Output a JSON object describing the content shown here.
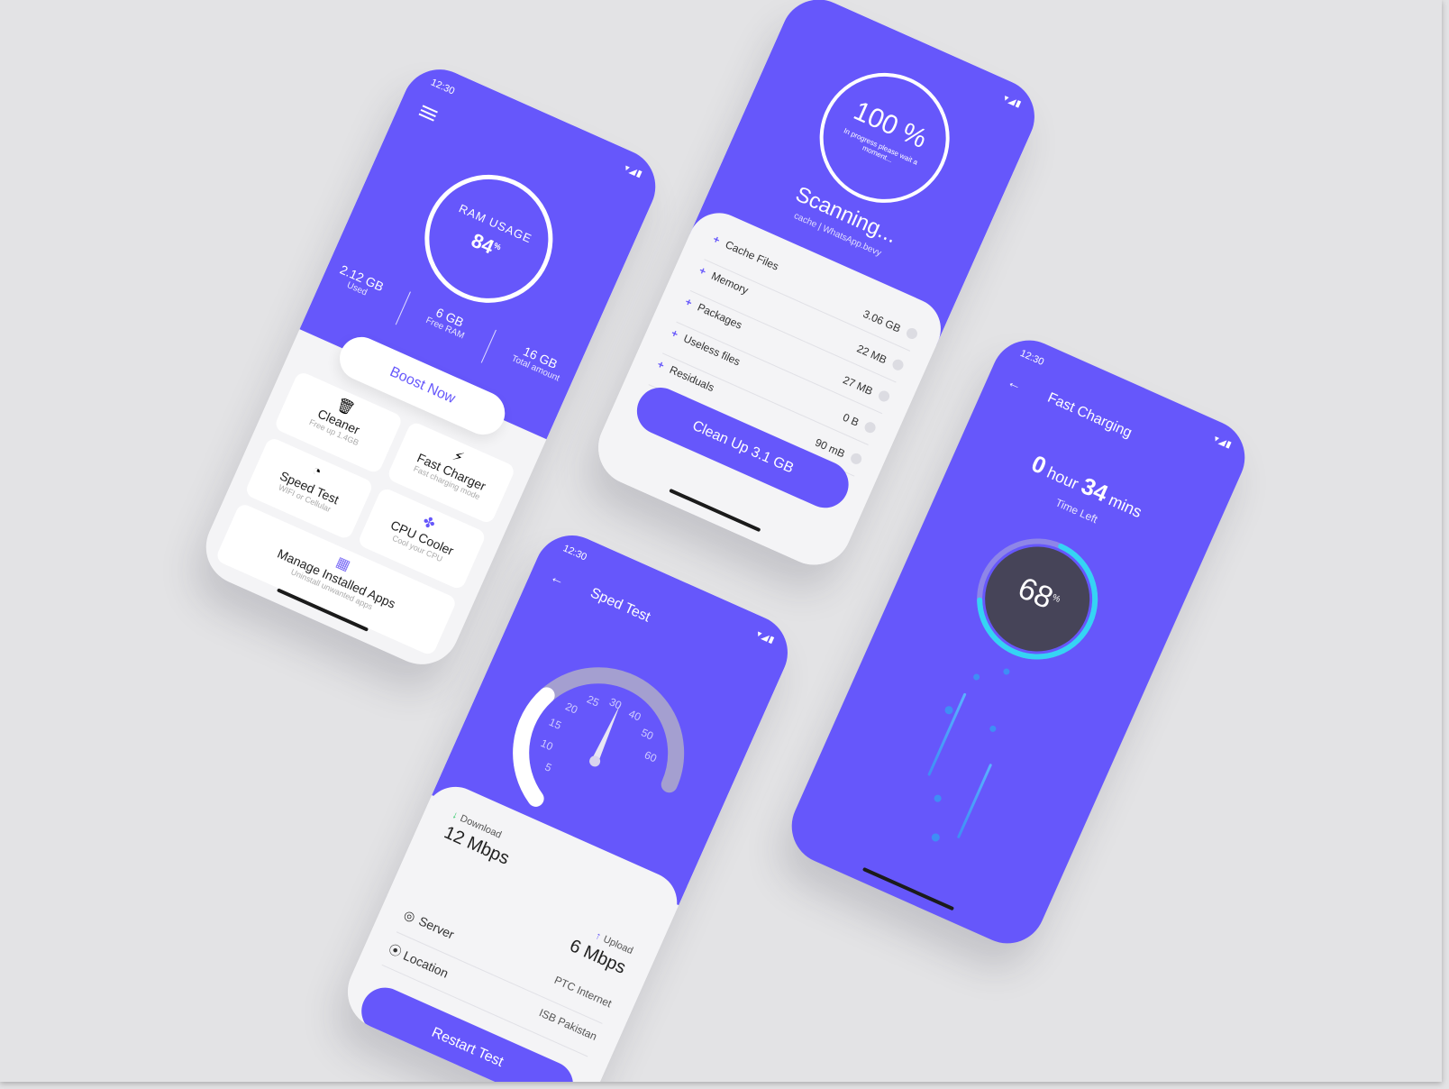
{
  "colors": {
    "primary": "#6657fb",
    "background": "#e3e3e5",
    "card": "#f4f4f6",
    "accent_cyan": "#35d4f4",
    "download_arrow": "#22c55e",
    "dark_dial": "#464458"
  },
  "status": {
    "time": "12:30",
    "icons": "▾◢▮"
  },
  "phone_ram": {
    "icon": "menu-icon",
    "ring_title": "RAM USAGE",
    "ring_value": "84",
    "ring_unit": "%",
    "used_value": "2.12 GB",
    "used_label": "Used",
    "free_value": "6 GB",
    "free_label": "Free RAM",
    "total_value": "16 GB",
    "total_label": "Total amount",
    "boost_label": "Boost Now",
    "cards": [
      {
        "title": "Cleaner",
        "subtitle": "Free up 1.4GB",
        "icon": "trash-icon"
      },
      {
        "title": "Fast Charger",
        "subtitle": "Fast charging mode",
        "icon": "charger-icon"
      },
      {
        "title": "Speed Test",
        "subtitle": "WIFI or Cellular",
        "icon": "speedometer-icon"
      },
      {
        "title": "CPU Cooler",
        "subtitle": "Cool your CPU",
        "icon": "fan-icon"
      },
      {
        "title": "Manage Installed Apps",
        "subtitle": "Uninstall unwanted apps",
        "icon": "apps-icon"
      }
    ]
  },
  "phone_scan": {
    "progress_value": "100 %",
    "progress_note": "In progress please wait a moment...",
    "heading": "Scanning...",
    "subheading": "cache | WhatsApp.bevy",
    "items": [
      {
        "label": "Cache Files",
        "value": "3.06 GB"
      },
      {
        "label": "Memory",
        "value": "22 MB"
      },
      {
        "label": "Packages",
        "value": "27 MB"
      },
      {
        "label": "Useless files",
        "value": "0 B"
      },
      {
        "label": "Residuals",
        "value": "90 mB"
      }
    ],
    "button_label": "Clean Up 3.1 GB"
  },
  "phone_speed": {
    "title": "Sped Test",
    "gauge_ticks": [
      "5",
      "10",
      "15",
      "20",
      "25",
      "30",
      "40",
      "50",
      "60"
    ],
    "gauge_level": 0.35,
    "download_label": "Download",
    "download_value": "12 Mbps",
    "upload_label": "Upload",
    "upload_value": "6 Mbps",
    "server_label": "Server",
    "server_value": "PTC Internet",
    "location_label": "Location",
    "location_value": "ISB Pakistan",
    "button_label": "Restart Test"
  },
  "phone_charge": {
    "title": "Fast Charging",
    "hours": "0",
    "hours_unit": "hour",
    "mins": "34",
    "mins_unit": "mins",
    "time_left_label": "Time Left",
    "battery_value": "68",
    "battery_unit": "%",
    "battery_level": 0.68
  }
}
